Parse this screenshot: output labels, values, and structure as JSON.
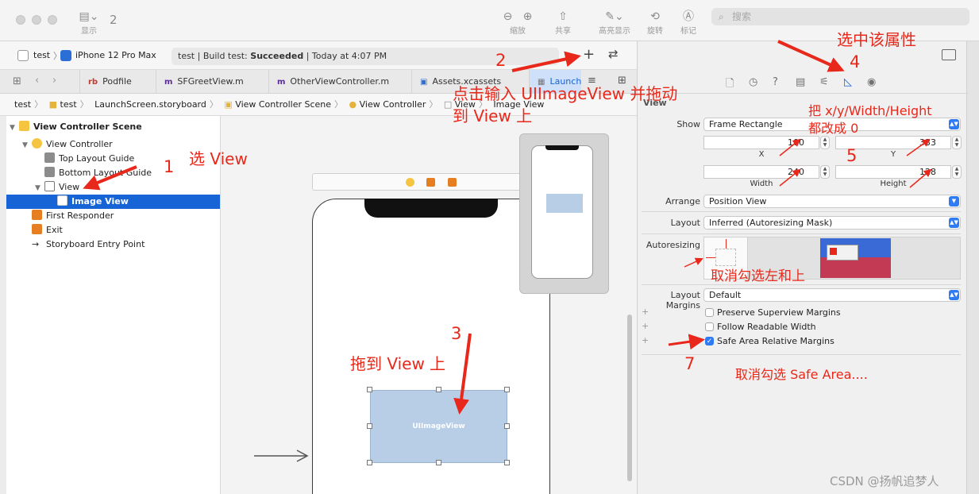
{
  "toolbar": {
    "badge_count": "2",
    "sidebar_label": "显示",
    "zoom_label": "缩放",
    "share_label": "共享",
    "highlight_label": "高亮显示",
    "rotate_label": "旋转",
    "markup_label": "标记",
    "search_placeholder": "搜索"
  },
  "scheme": {
    "project": "test",
    "device": "iPhone 12 Pro Max",
    "status_prefix": "test | Build test: ",
    "status_bold": "Succeeded",
    "status_suffix": " | Today at 4:07 PM"
  },
  "tabs": [
    {
      "label": "Podfile"
    },
    {
      "label": "SFGreetView.m"
    },
    {
      "label": "OtherViewController.m"
    },
    {
      "label": "Assets.xcassets"
    },
    {
      "label": "Launch"
    }
  ],
  "breadcrumbs": [
    "test",
    "test",
    "LaunchScreen.storyboard",
    "View Controller Scene",
    "View Controller",
    "View",
    "Image View"
  ],
  "outline": [
    {
      "label": "View Controller Scene",
      "depth": 0,
      "disclosure": "▼",
      "icon": "scene-icon",
      "bold": true
    },
    {
      "label": "View Controller",
      "depth": 1,
      "disclosure": "▼",
      "icon": "controller-icon"
    },
    {
      "label": "Top Layout Guide",
      "depth": 2,
      "disclosure": "",
      "icon": "layout-guide-icon"
    },
    {
      "label": "Bottom Layout Guide",
      "depth": 2,
      "disclosure": "",
      "icon": "layout-guide-icon"
    },
    {
      "label": "View",
      "depth": 2,
      "disclosure": "▼",
      "icon": "view-icon"
    },
    {
      "label": "Image View",
      "depth": 3,
      "disclosure": "",
      "icon": "image-view-icon",
      "selected": true
    },
    {
      "label": "First Responder",
      "depth": 1,
      "disclosure": "",
      "icon": "first-responder-icon"
    },
    {
      "label": "Exit",
      "depth": 1,
      "disclosure": "",
      "icon": "exit-icon"
    },
    {
      "label": "Storyboard Entry Point",
      "depth": 1,
      "disclosure": "",
      "icon": "entry-point-icon"
    }
  ],
  "canvas": {
    "imageview_label": "UIImageView"
  },
  "inspector": {
    "section_title": "View",
    "show_label": "Show",
    "show_value": "Frame Rectangle",
    "x_value": "100",
    "y_value": "333",
    "width_value": "240",
    "height_value": "128",
    "x_label": "X",
    "y_label": "Y",
    "width_label": "Width",
    "height_label": "Height",
    "arrange_label": "Arrange",
    "arrange_value": "Position View",
    "layout_label": "Layout",
    "layout_value": "Inferred (Autoresizing Mask)",
    "autoresizing_label": "Autoresizing",
    "margins_label": "Layout Margins",
    "margins_value": "Default",
    "checkboxes": [
      {
        "label": "Preserve Superview Margins",
        "checked": false
      },
      {
        "label": "Follow Readable Width",
        "checked": false
      },
      {
        "label": "Safe Area Relative Margins",
        "checked": true
      }
    ]
  },
  "annotations": {
    "n1": "1",
    "select_view": "选 View",
    "n2": "2",
    "click_input_line1": "点击输入 UIImageView 并拖动",
    "click_input_line2": "到 View 上",
    "n3": "3",
    "drag_to_view": "拖到 View 上",
    "select_attr": "选中该属性",
    "n4": "4",
    "set_xywh_line1": "把 x/y/Width/Height",
    "set_xywh_line2": "都改成 0",
    "n5": "5",
    "uncheck_left_top": "取消勾选左和上",
    "n7": "7",
    "uncheck_safe_area": "取消勾选 Safe Area...."
  },
  "watermark": "CSDN @扬帆追梦人",
  "colors": {
    "accent": "#1764d6",
    "annotation": "#e8281a",
    "imageview_fill": "#b8cde6"
  }
}
